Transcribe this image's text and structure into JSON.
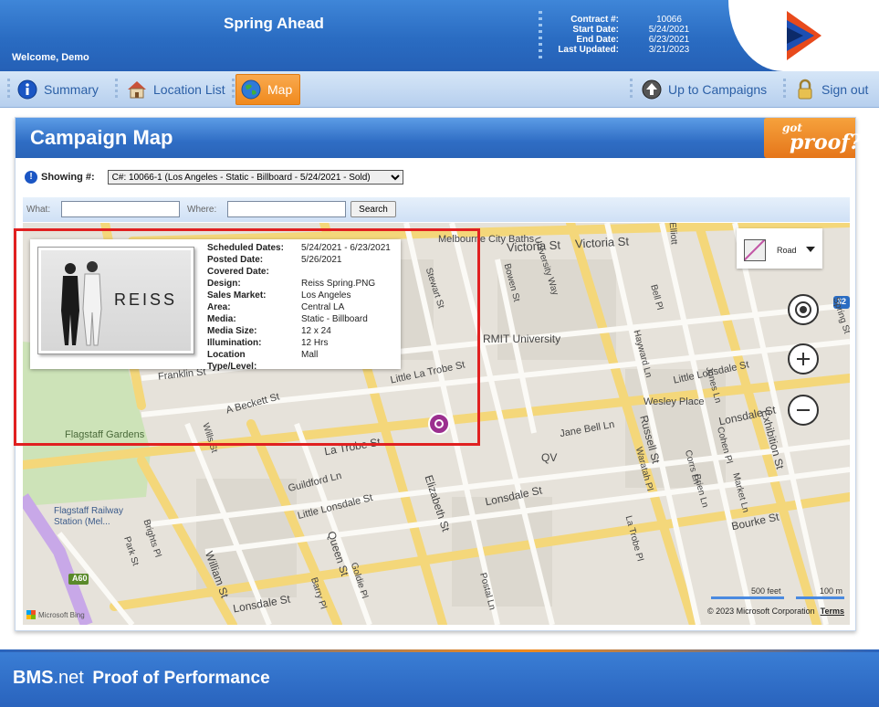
{
  "header": {
    "app_title": "Spring Ahead",
    "welcome": "Welcome, Demo",
    "contract": [
      {
        "label": "Contract #:",
        "value": "10066"
      },
      {
        "label": "Start Date:",
        "value": "5/24/2021"
      },
      {
        "label": "End Date:",
        "value": "6/23/2021"
      },
      {
        "label": "Last Updated:",
        "value": "3/21/2023"
      }
    ]
  },
  "nav": {
    "summary": "Summary",
    "location_list": "Location List",
    "map": "Map",
    "up_to_campaigns": "Up to Campaigns",
    "sign_out": "Sign out",
    "active": "map"
  },
  "panel": {
    "title": "Campaign Map",
    "got_proof_small": "got",
    "got_proof_big": "proof?",
    "showing_label": "Showing #:",
    "showing_value": "C#: 10066-1 (Los Angeles - Static - Billboard - 5/24/2021 - Sold)",
    "what_label": "What:",
    "where_label": "Where:",
    "what_value": "",
    "where_value": "",
    "search_button": "Search"
  },
  "popup": {
    "brand": "REISS",
    "details": [
      {
        "key": "Scheduled Dates:",
        "value": "5/24/2021 - 6/23/2021"
      },
      {
        "key": "Posted Date:",
        "value": "5/26/2021"
      },
      {
        "key": "Covered Date:",
        "value": ""
      },
      {
        "key": "Design:",
        "value": "Reiss Spring.PNG"
      },
      {
        "key": "Sales Market:",
        "value": "Los Angeles"
      },
      {
        "key": "Area:",
        "value": "Central LA"
      },
      {
        "key": "Media:",
        "value": "Static - Billboard"
      },
      {
        "key": "Media Size:",
        "value": "12 x 24"
      },
      {
        "key": "Illumination:",
        "value": "12 Hrs"
      },
      {
        "key": "Location Type/Level:",
        "value": "Mall"
      }
    ]
  },
  "map": {
    "style_label": "Road",
    "scale_feet": "500 feet",
    "scale_m": "100 m",
    "copyright": "© 2023 Microsoft Corporation",
    "terms": "Terms",
    "bing": "Microsoft Bing",
    "labels": {
      "melbourne_city_baths": "Melbourne City Baths",
      "victoria_st_1": "Victoria St",
      "victoria_st_2": "Victoria St",
      "rmit": "RMIT University",
      "franklin_st": "Franklin St",
      "little_la_trobe": "Little La Trobe St",
      "a_beckett": "A Beckett St",
      "la_trobe": "La Trobe St",
      "flagstaff_gardens": "Flagstaff Gardens",
      "flagstaff_station": "Flagstaff Railway Station (Mel...",
      "guildford": "Guildford Ln",
      "little_lonsdale": "Little Lonsdale St",
      "lonsdale_1": "Lonsdale St",
      "lonsdale_2": "Lonsdale St",
      "lonsdale_3": "Lonsdale St",
      "little_lonsdale_2": "Little Lonsdale St",
      "elizabeth": "Elizabeth St",
      "queen": "Queen St",
      "william": "William St",
      "russell": "Russell St",
      "exhibition": "Exhibition St",
      "wesley": "Wesley Place",
      "qv": "QV",
      "bourke": "Bourke St",
      "jane_bell": "Jane Bell Ln",
      "a60": "A60",
      "r32": "32",
      "stewart": "Stewart St",
      "bowen": "Bowen St",
      "hayward": "Hayward Ln",
      "jones": "Jones Ln",
      "cohen": "Cohen Pl",
      "market": "Market Ln",
      "brien": "Brien Ln",
      "la_trobe_pl": "La Trobe Pl",
      "waratah": "Waratah Pl",
      "corrs": "Corrs Ln",
      "postal": "Postal Ln",
      "park": "Park St",
      "bright": "Brights Pl",
      "wills": "Wills St",
      "goldie": "Goldie Pl",
      "barry": "Barry Pl",
      "elliott": "Elliott",
      "bell": "Bell Pl",
      "university_way": "University Way",
      "franklin_st_2": "Franklin St",
      "spring": "Spring St"
    }
  },
  "footer": {
    "brand_bold": "BMS",
    "brand_net": ".net",
    "tagline": "Proof of Performance"
  },
  "colors": {
    "header_blue": "#2a6cc2",
    "nav_active_orange": "#f08a1e",
    "highlight_red": "#e02020",
    "marker_purple": "#9b2f8f"
  }
}
